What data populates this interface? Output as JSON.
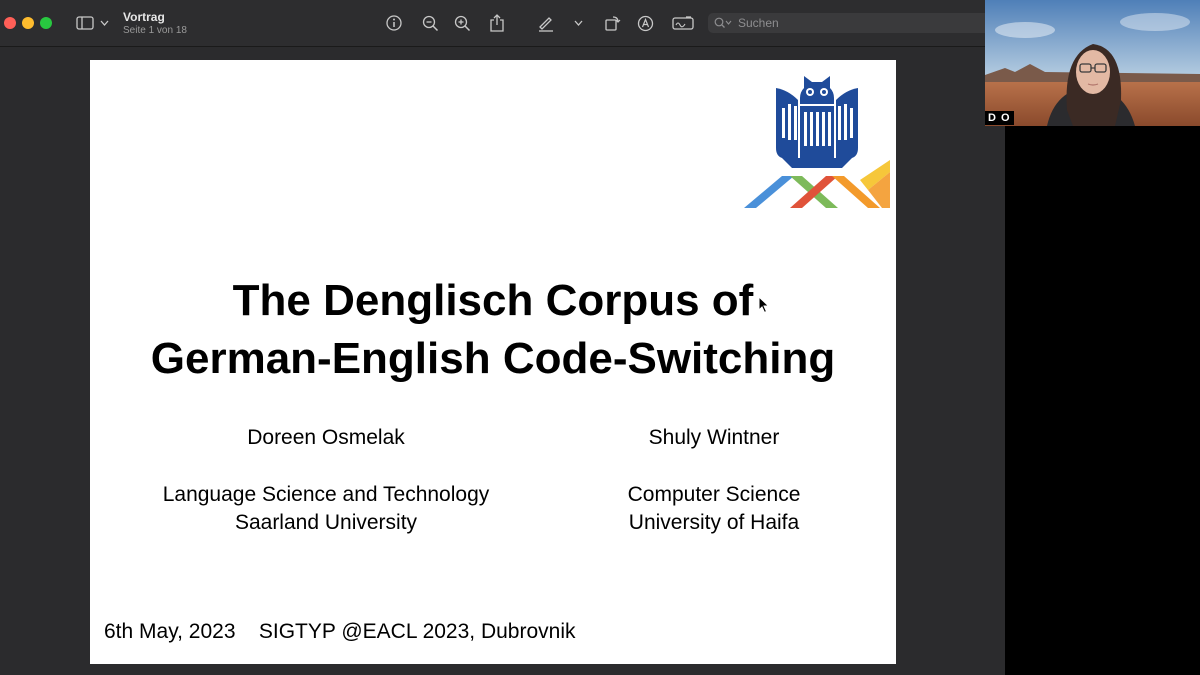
{
  "window": {
    "title": "Vortrag",
    "subtitle": "Seite 1 von 18",
    "search_placeholder": "Suchen"
  },
  "toolbar": {
    "icons": [
      "sidebar-icon",
      "chevron-down-icon",
      "info-icon",
      "zoom-out-icon",
      "zoom-in-icon",
      "share-icon",
      "markup-pen-icon",
      "chevron-down-icon",
      "rotate-icon",
      "annotate-icon",
      "signature-icon",
      "search-icon"
    ]
  },
  "slide": {
    "title_line1": "The Denglisch Corpus of",
    "title_line2": "German-English Code-Switching",
    "author_left": "Doreen Osmelak",
    "affil_left_1": "Language Science and Technology",
    "affil_left_2": "Saarland University",
    "author_right": "Shuly Wintner",
    "affil_right_1": "Computer Science",
    "affil_right_2": "University of Haifa",
    "footer": "6th May, 2023    SIGTYP @EACL 2023, Dubrovnik"
  },
  "video": {
    "participant_label": "D O"
  },
  "colors": {
    "owl_blue": "#1f4b9a",
    "logo_blue": "#4a90d9",
    "logo_green": "#7dba5a",
    "logo_red": "#e0533a",
    "logo_orange": "#f39a2b",
    "logo_yellow": "#f6c73a"
  }
}
